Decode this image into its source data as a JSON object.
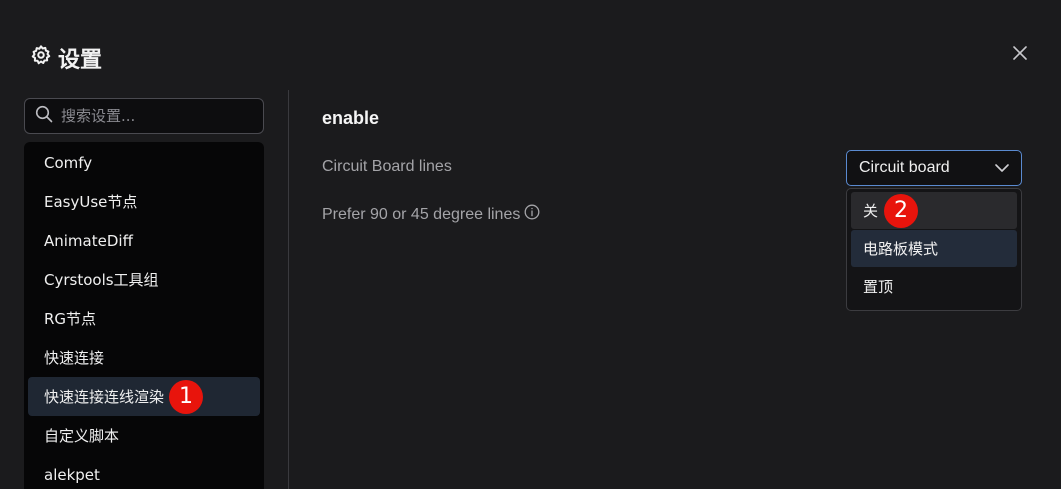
{
  "dialog": {
    "title": "设置",
    "icons": {
      "title": "gear-icon",
      "close": "close-icon"
    }
  },
  "search": {
    "placeholder": "搜索设置...",
    "value": ""
  },
  "sidebar": {
    "items": [
      {
        "label": "Comfy"
      },
      {
        "label": "EasyUse节点"
      },
      {
        "label": "AnimateDiff"
      },
      {
        "label": "Cyrstools工具组"
      },
      {
        "label": "RG节点"
      },
      {
        "label": "快速连接"
      },
      {
        "label": "快速连接连线渲染",
        "active": true
      },
      {
        "label": "自定义脚本"
      },
      {
        "label": "alekpet"
      }
    ]
  },
  "main": {
    "section_title": "enable",
    "settings": [
      {
        "label": "Circuit Board lines",
        "value": "Circuit board"
      },
      {
        "label": "Prefer 90 or 45 degree lines",
        "icon": "info-icon"
      }
    ]
  },
  "dropdown": {
    "options": [
      {
        "label": "关"
      },
      {
        "label": "电路板模式",
        "selected": true
      },
      {
        "label": "置顶"
      }
    ]
  },
  "annotations": {
    "badge1": "1",
    "badge2": "2"
  },
  "colors": {
    "background": "#1b1b1d",
    "sidebar_bg": "#060607",
    "active_item": "#1f2733",
    "select_border": "#5a8ad0",
    "badge": "#e8140c"
  }
}
